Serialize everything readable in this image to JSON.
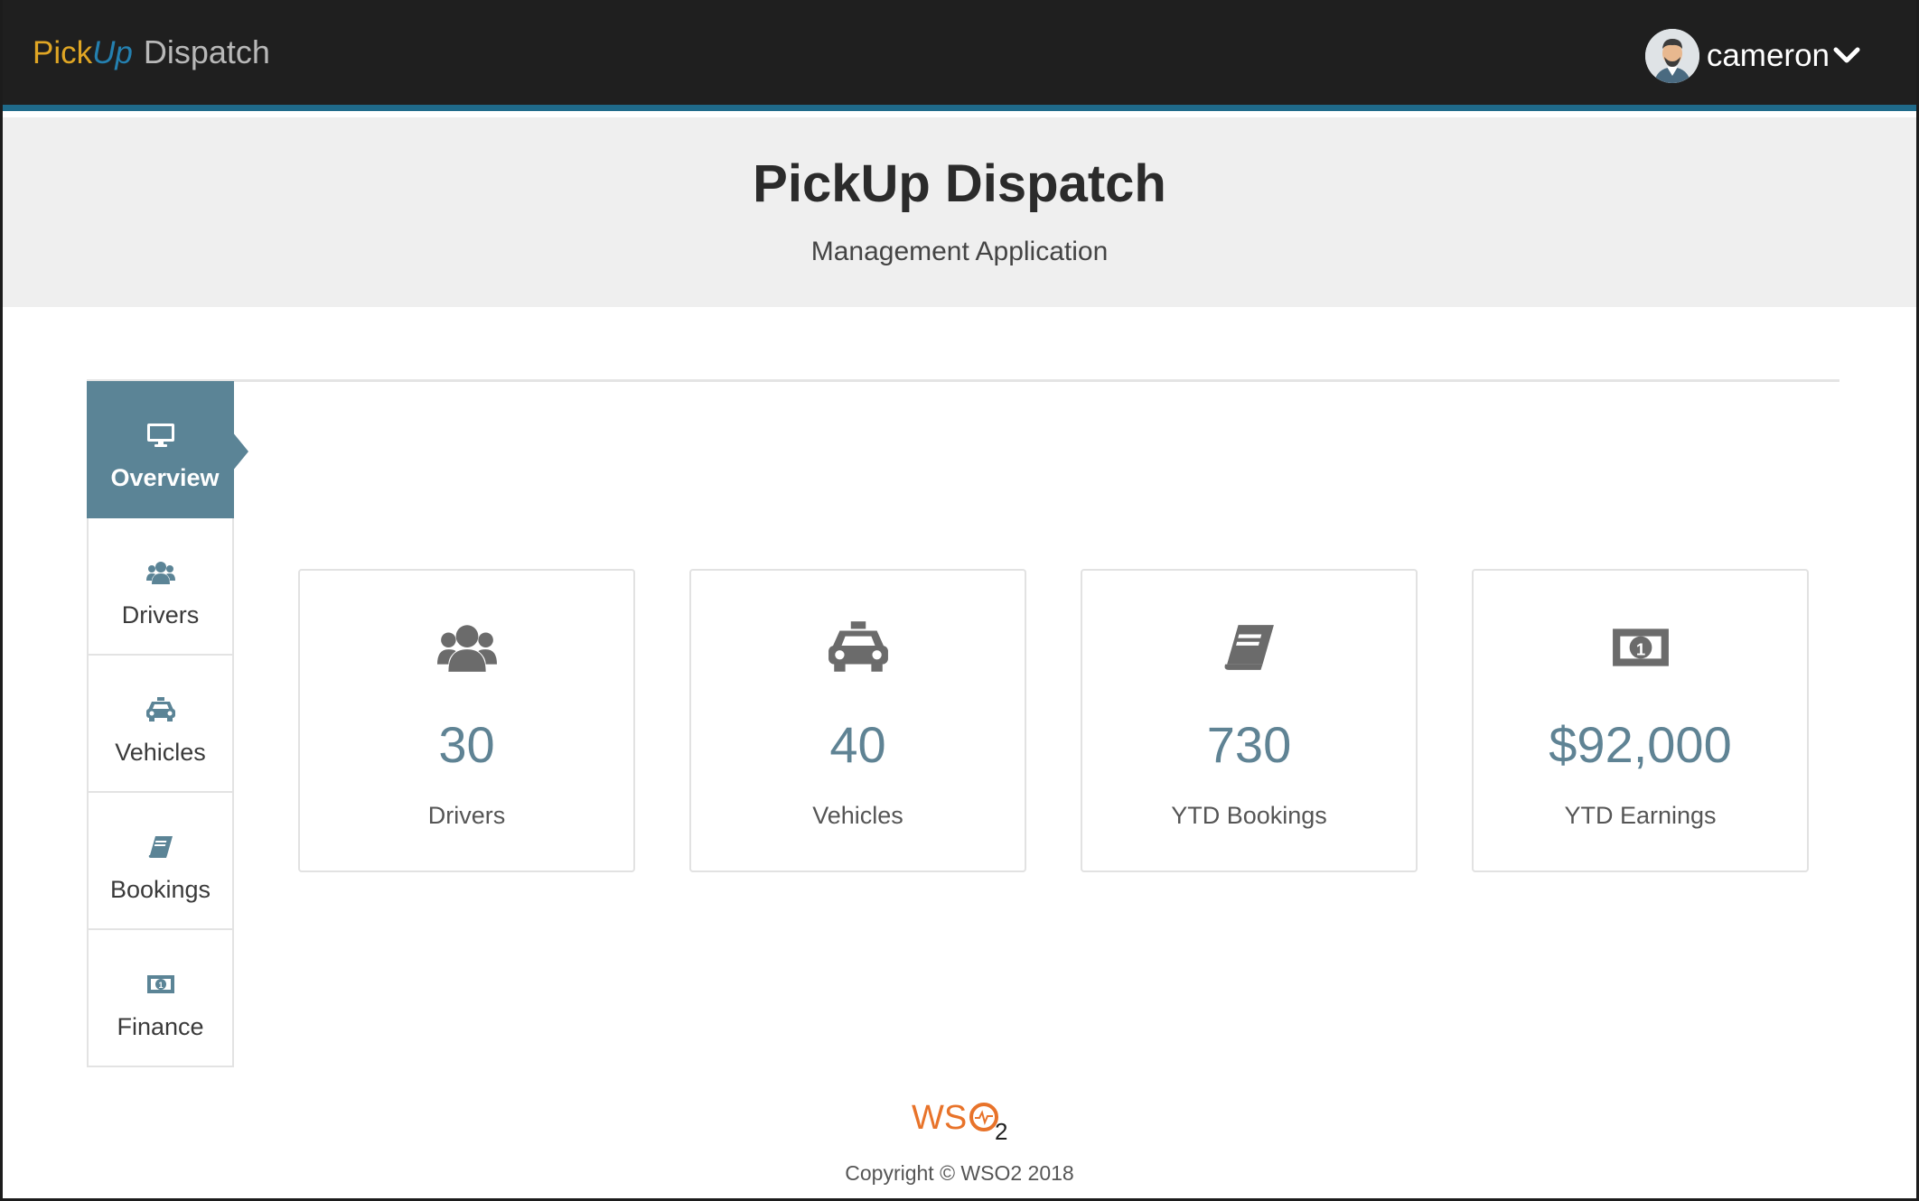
{
  "navbar": {
    "brand_pick": "Pick",
    "brand_up": "Up",
    "brand_dispatch": "Dispatch",
    "user_name": "cameron"
  },
  "hero": {
    "title": "PickUp Dispatch",
    "subtitle": "Management Application"
  },
  "tabs": [
    {
      "label": "Overview",
      "icon": "monitor-icon",
      "active": true
    },
    {
      "label": "Drivers",
      "icon": "users-icon",
      "active": false
    },
    {
      "label": "Vehicles",
      "icon": "taxi-icon",
      "active": false
    },
    {
      "label": "Bookings",
      "icon": "book-icon",
      "active": false
    },
    {
      "label": "Finance",
      "icon": "money-icon",
      "active": false
    }
  ],
  "stats": [
    {
      "value": "30",
      "label": "Drivers",
      "icon": "users-icon"
    },
    {
      "value": "40",
      "label": "Vehicles",
      "icon": "taxi-icon"
    },
    {
      "value": "730",
      "label": "YTD Bookings",
      "icon": "book-icon"
    },
    {
      "value": "$92,000",
      "label": "YTD Earnings",
      "icon": "money-icon"
    }
  ],
  "footer": {
    "logo_text": "WSO",
    "logo_sub": "2",
    "copyright": "Copyright © WSO2 2018"
  },
  "colors": {
    "navbar_bg": "#1f1f1f",
    "navbar_accent": "#1f6a8a",
    "active_tab": "#5b8496",
    "stat_value": "#5f8394",
    "brand_pick": "#e0a624",
    "brand_up": "#2480b0"
  }
}
